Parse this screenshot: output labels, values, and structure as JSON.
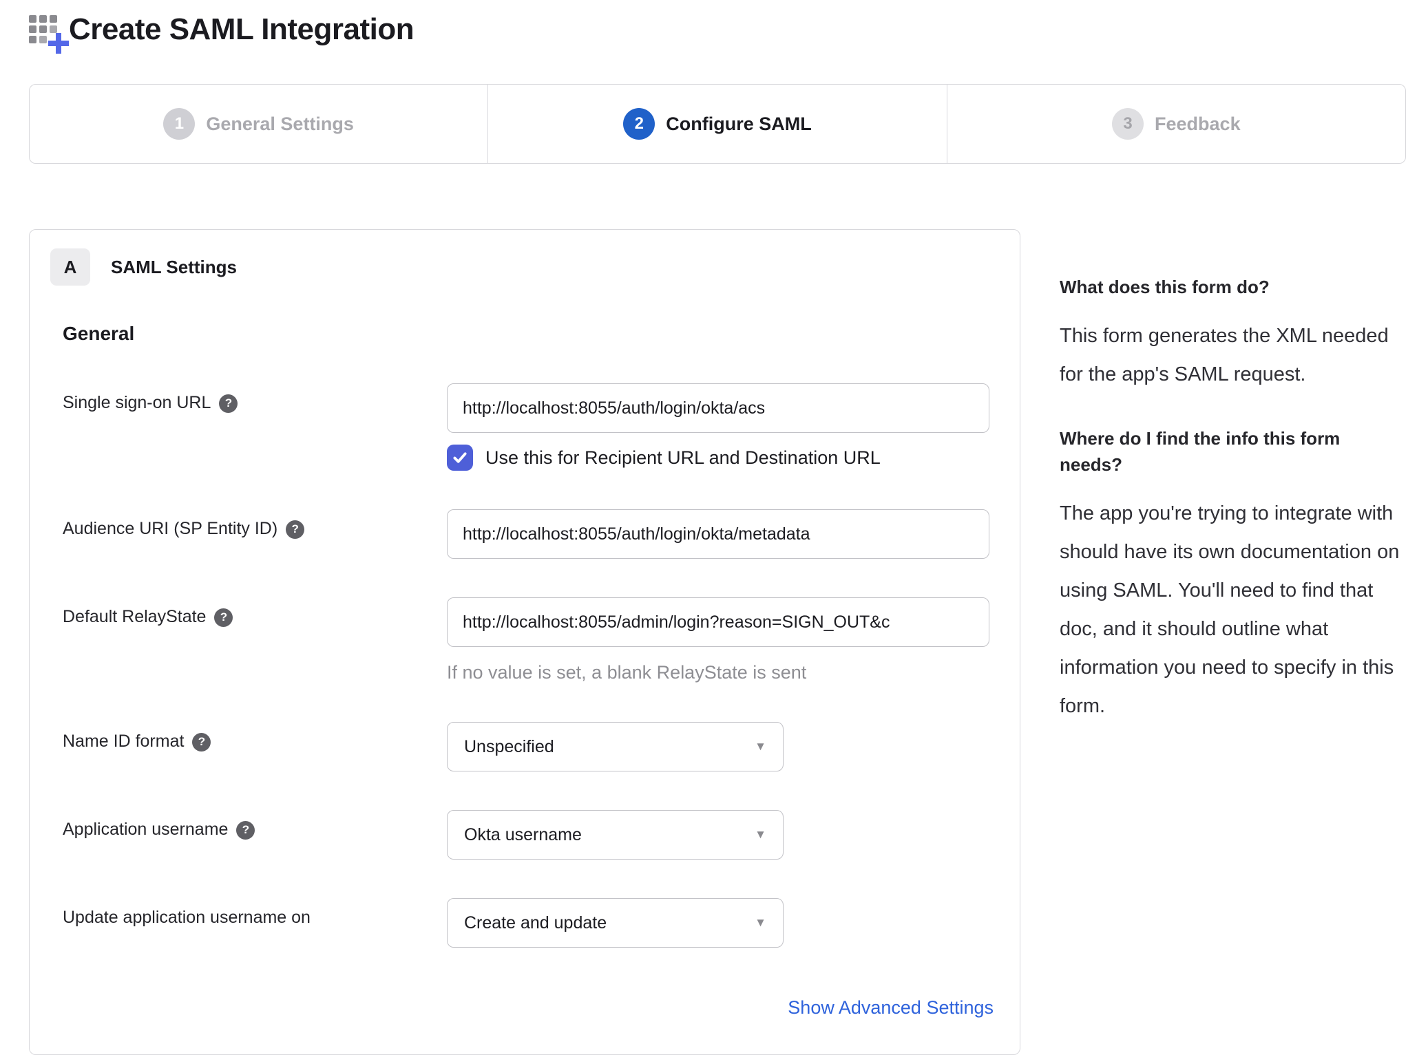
{
  "header": {
    "title": "Create SAML Integration"
  },
  "wizard": {
    "steps": [
      {
        "number": "1",
        "label": "General Settings",
        "state": "done"
      },
      {
        "number": "2",
        "label": "Configure SAML",
        "state": "active"
      },
      {
        "number": "3",
        "label": "Feedback",
        "state": "upcoming"
      }
    ]
  },
  "panel": {
    "section_badge": "A",
    "section_title": "SAML Settings",
    "group_title": "General",
    "fields": {
      "sso_url": {
        "label": "Single sign-on URL",
        "value": "http://localhost:8055/auth/login/okta/acs"
      },
      "sso_checkbox": {
        "label": "Use this for Recipient URL and Destination URL",
        "checked": true
      },
      "audience_uri": {
        "label": "Audience URI (SP Entity ID)",
        "value": "http://localhost:8055/auth/login/okta/metadata"
      },
      "relay_state": {
        "label": "Default RelayState",
        "value": "http://localhost:8055/admin/login?reason=SIGN_OUT&c",
        "hint": "If no value is set, a blank RelayState is sent"
      },
      "name_id_format": {
        "label": "Name ID format",
        "value": "Unspecified"
      },
      "app_username": {
        "label": "Application username",
        "value": "Okta username"
      },
      "update_app_username": {
        "label": "Update application username on",
        "value": "Create and update"
      }
    },
    "advanced_link": "Show Advanced Settings"
  },
  "sidebar": {
    "sections": [
      {
        "heading": "What does this form do?",
        "body": "This form generates the XML needed for the app's SAML request."
      },
      {
        "heading": "Where do I find the info this form needs?",
        "body": "The app you're trying to integrate with should have its own documentation on using SAML. You'll need to find that doc, and it should outline what information you need to specify in this form."
      }
    ]
  },
  "icons": {
    "title_icon": "grid-plus-icon",
    "help_glyph": "?",
    "chevron_glyph": "▼",
    "checkbox_icon": "checkmark-icon"
  },
  "colors": {
    "active_step_blue": "#2061c9",
    "checkbox_indigo": "#4e5fd8",
    "link_blue": "#2f63dc",
    "border_gray": "#d8d8dc",
    "muted_text": "#a9a9ae",
    "hint_gray": "#8e8e93"
  }
}
